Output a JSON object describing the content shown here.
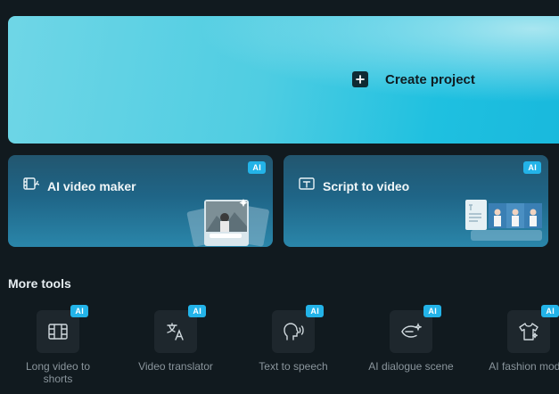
{
  "create": {
    "label": "Create project",
    "icon": "plus-icon"
  },
  "cards": [
    {
      "title": "AI video maker",
      "badge": "AI",
      "icon": "ai-video-maker-icon"
    },
    {
      "title": "Script to video",
      "badge": "AI",
      "icon": "script-to-video-icon"
    }
  ],
  "more_tools": {
    "title": "More tools",
    "items": [
      {
        "label": "Long video to shorts",
        "badge": "AI",
        "icon": "film-split-icon"
      },
      {
        "label": "Video translator",
        "badge": "AI",
        "icon": "translate-icon"
      },
      {
        "label": "Text to speech",
        "badge": "AI",
        "icon": "speaking-head-icon"
      },
      {
        "label": "AI dialogue scene",
        "badge": "AI",
        "icon": "dialogue-sparkle-icon"
      },
      {
        "label": "AI fashion model",
        "badge": "AI",
        "icon": "tshirt-sparkle-icon"
      }
    ]
  },
  "colors": {
    "accent": "#23b3e8",
    "background": "#111a1f",
    "create_gradient_end": "#18b8dc"
  }
}
